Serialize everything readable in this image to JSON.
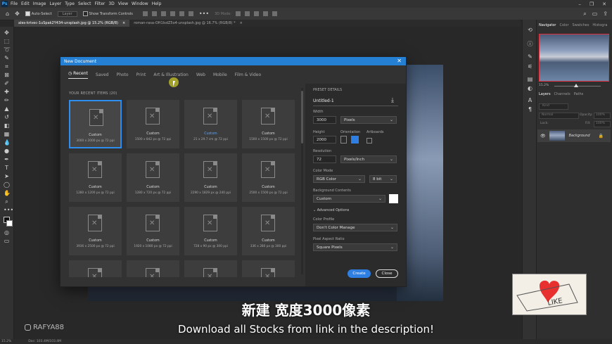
{
  "app": {
    "logo": "Ps"
  },
  "menu": [
    "File",
    "Edit",
    "Image",
    "Layer",
    "Type",
    "Select",
    "Filter",
    "3D",
    "View",
    "Window",
    "Help"
  ],
  "options_bar": {
    "auto_select_label": "Auto-Select",
    "layer_select": "Layer",
    "transform_label": "Show Transform Controls",
    "mode_3d": "3D Mode:"
  },
  "tabs": [
    {
      "label": "ales-krivec-1uSpak2Y434-unsplash.jpg @ 15.2% (RGB/8)",
      "close": "×"
    },
    {
      "label": "roman-rasa-OH1IsdZ5o4-unsplash.jpg @ 16.7% (RGB/8) *",
      "close": "×"
    }
  ],
  "dialog": {
    "title": "New Document",
    "close": "✕",
    "tabs": [
      "Recent",
      "Saved",
      "Photo",
      "Print",
      "Art & Illustration",
      "Web",
      "Mobile",
      "Film & Video"
    ],
    "recent_title": "YOUR RECENT ITEMS (20)",
    "items": [
      {
        "name": "Custom",
        "dims": "3000 x 2000 px @ 72 ppi",
        "selected": true
      },
      {
        "name": "Custom",
        "dims": "1500 x 842 px @ 72 ppi"
      },
      {
        "name": "Custom",
        "dims": "21 x 29.7 cm @ 72 ppi",
        "highlight": true
      },
      {
        "name": "Custom",
        "dims": "1500 x 1500 px @ 72 ppi"
      },
      {
        "name": "Custom",
        "dims": "1280 x 1200 px @ 72 ppi"
      },
      {
        "name": "Custom",
        "dims": "1280 x 720 px @ 72 ppi"
      },
      {
        "name": "Custom",
        "dims": "2290 x 1829 px @ 240 ppi"
      },
      {
        "name": "Custom",
        "dims": "2500 x 1500 px @ 72 ppi"
      },
      {
        "name": "Custom",
        "dims": "3936 x 2500 px @ 72 ppi"
      },
      {
        "name": "Custom",
        "dims": "1920 x 1080 px @ 72 ppi"
      },
      {
        "name": "Custom",
        "dims": "728 x 90 px @ 300 ppi"
      },
      {
        "name": "Custom",
        "dims": "336 x 280 px @ 300 ppi"
      },
      {
        "name": "",
        "dims": ""
      },
      {
        "name": "",
        "dims": ""
      },
      {
        "name": "",
        "dims": ""
      },
      {
        "name": "",
        "dims": ""
      }
    ],
    "preset": {
      "heading": "PRESET DETAILS",
      "name": "Untitled-1",
      "width_label": "Width",
      "width": "3000",
      "width_unit": "Pixels",
      "height_label": "Height",
      "height": "2000",
      "orientation_label": "Orientation",
      "artboards_label": "Artboards",
      "resolution_label": "Resolution",
      "resolution": "72",
      "resolution_unit": "Pixels/Inch",
      "color_mode_label": "Color Mode",
      "color_mode": "RGB Color",
      "bit_depth": "8 bit",
      "bg_label": "Background Contents",
      "bg_value": "Custom",
      "advanced": "Advanced Options",
      "profile_label": "Color Profile",
      "profile": "Don't Color Manage",
      "aspect_label": "Pixel Aspect Ratio",
      "aspect": "Square Pixels"
    },
    "create": "Create",
    "close_btn": "Close"
  },
  "panels": {
    "top_tabs": [
      "Navigator",
      "Color",
      "Swatches",
      "Histogra"
    ],
    "zoom": "15.2%",
    "layer_tabs": [
      "Layers",
      "Channels",
      "Paths"
    ],
    "kind": "Kind",
    "blend": "Normal",
    "opacity_label": "Opacity:",
    "opacity": "100%",
    "lock_label": "Lock:",
    "fill_label": "Fill:",
    "fill": "100%",
    "layer_name": "Background"
  },
  "status": {
    "zoom": "15.2%",
    "doc": "Doc: 103.4M/103.4M"
  },
  "overlay": {
    "subtitle_cn": "新建 宽度3000像素",
    "subtitle_en": "Download all Stocks from link in the description!",
    "watermark": "RAFYA88",
    "like_text": "LIKE"
  },
  "colors": {
    "accent": "#2f7fe3",
    "title_bar": "#2580d3",
    "nav_frame": "#e0313f"
  }
}
